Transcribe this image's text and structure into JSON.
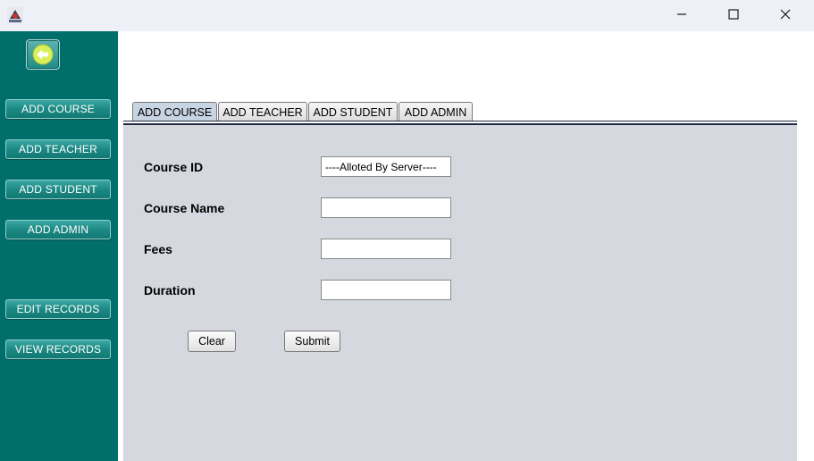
{
  "window": {
    "icons": {
      "app": "java-app-icon",
      "minimize": "minimize-icon",
      "maximize": "maximize-icon",
      "close": "close-icon"
    }
  },
  "sidebar": {
    "back_icon": "back-arrow-icon",
    "buttons": [
      {
        "label": "ADD COURSE"
      },
      {
        "label": "ADD TEACHER"
      },
      {
        "label": "ADD STUDENT"
      },
      {
        "label": "ADD ADMIN"
      },
      {
        "label": "EDIT RECORDS"
      },
      {
        "label": "VIEW RECORDS"
      }
    ]
  },
  "tabs": [
    {
      "label": "ADD COURSE",
      "active": true
    },
    {
      "label": "ADD TEACHER",
      "active": false
    },
    {
      "label": "ADD STUDENT",
      "active": false
    },
    {
      "label": "ADD ADMIN",
      "active": false
    }
  ],
  "form": {
    "course_id": {
      "label": "Course ID",
      "value": "----Alloted By Server----"
    },
    "course_name": {
      "label": "Course Name",
      "value": ""
    },
    "fees": {
      "label": "Fees",
      "value": ""
    },
    "duration": {
      "label": "Duration",
      "value": ""
    },
    "clear_label": "Clear",
    "submit_label": "Submit"
  },
  "colors": {
    "sidebar": "#006e6a",
    "panel": "#d6d8e0",
    "active_tab": "#c9d4e3"
  }
}
